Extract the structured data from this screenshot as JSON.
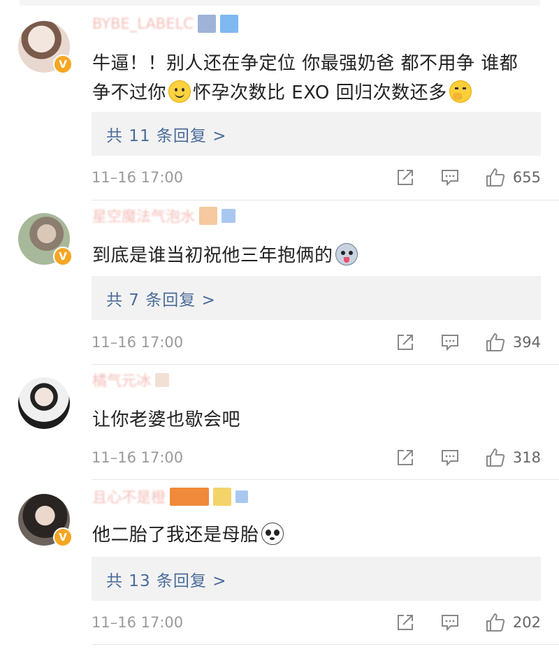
{
  "comments": [
    {
      "username": "BYBE_LABELC",
      "text_part1": "牛逼！！别人还在争定位 你最强奶爸 都不用争 谁都争不过你",
      "text_part2": "怀孕次数比 EXO 回归次数还多",
      "emoji_1": "smile-emoji",
      "emoji_2": "thinking-emoji",
      "reply_link": "共 11 条回复 >",
      "timestamp": "11–16 17:00",
      "likes": "655",
      "avatar_color": "#d8c8c0",
      "badge": "V"
    },
    {
      "username": "星空魔法气泡水",
      "text_part1": "到底是谁当初祝他三年抱俩的",
      "emoji_1": "husky-emoji",
      "reply_link": "共 7 条回复 >",
      "timestamp": "11–16 17:00",
      "likes": "394",
      "avatar_color": "#b9a99a",
      "badge": "V"
    },
    {
      "username": "橘气元冰",
      "text_part1": "让你老婆也歇会吧",
      "timestamp": "11–16 17:00",
      "likes": "318",
      "avatar_color": "#e9e9e9"
    },
    {
      "username": "且心不是橙",
      "text_part1": "他二胎了我还是母胎",
      "emoji_1": "panda-emoji",
      "reply_link": "共 13 条回复 >",
      "timestamp": "11–16 17:00",
      "likes": "202",
      "avatar_color": "#3a3330",
      "badge": "V"
    }
  ],
  "colors": {
    "reply_link": "#4a6c9a",
    "reply_box_bg": "#f2f2f2",
    "meta_text": "#9a9a9a",
    "username": "#f0a7a0",
    "badge": "#f5a623"
  }
}
